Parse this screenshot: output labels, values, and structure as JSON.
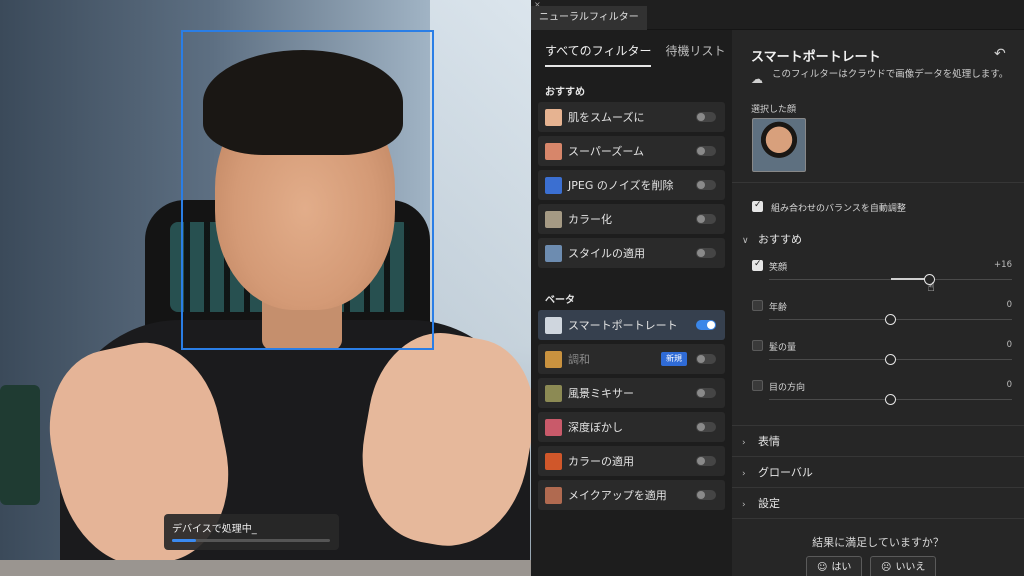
{
  "canvas": {
    "processing_text": "デバイスで処理中_",
    "progress": 0.15
  },
  "panel": {
    "tab_title": "ニューラルフィルター",
    "close_glyph": "×"
  },
  "filter_tabs": [
    "すべてのフィルター",
    "待機リスト"
  ],
  "sections": {
    "recommended": "おすすめ",
    "beta": "ベータ"
  },
  "recommended_filters": [
    {
      "label": "肌をスムーズに",
      "on": false,
      "thumb_color": "#e6b391"
    },
    {
      "label": "スーパーズーム",
      "on": false,
      "thumb_color": "#d7866a"
    },
    {
      "label": "JPEG のノイズを削除",
      "on": false,
      "thumb_color": "#3b6fd1"
    },
    {
      "label": "カラー化",
      "on": false,
      "thumb_color": "#a59a84"
    },
    {
      "label": "スタイルの適用",
      "on": false,
      "thumb_color": "#6d8cb0"
    }
  ],
  "beta_filters": [
    {
      "label": "スマートポートレート",
      "on": true,
      "thumb_color": "#cfd6de"
    },
    {
      "label": "調和",
      "on": false,
      "badge": "新規",
      "thumb_color": "#c9923f"
    },
    {
      "label": "風景ミキサー",
      "on": false,
      "thumb_color": "#8c8a54"
    },
    {
      "label": "深度ぼかし",
      "on": false,
      "thumb_color": "#c95a6a"
    },
    {
      "label": "カラーの適用",
      "on": false,
      "thumb_color": "#d0572a"
    },
    {
      "label": "メイクアップを適用",
      "on": false,
      "thumb_color": "#b06a50"
    }
  ],
  "settings": {
    "title": "スマートポートレート",
    "reset_icon": "↶",
    "cloud_icon": "☁",
    "cloud_text": "このフィルターはクラウドで画像データを処理します。",
    "selected_faces_label": "選択した顔",
    "auto_balance_label": "組み合わせのバランスを自動調整",
    "auto_balance_checked": true,
    "recommended_section": "おすすめ",
    "sliders": [
      {
        "label": "笑顔",
        "value_text": "+16",
        "value": 16,
        "checked": true
      },
      {
        "label": "年齢",
        "value_text": "0",
        "value": 0,
        "checked": false
      },
      {
        "label": "髪の量",
        "value_text": "0",
        "value": 0,
        "checked": false
      },
      {
        "label": "目の方向",
        "value_text": "0",
        "value": 0,
        "checked": false
      }
    ],
    "slider_range": [
      -50,
      50
    ],
    "collapsed_sections": [
      "表情",
      "グローバル",
      "設定"
    ],
    "feedback_question": "結果に満足していますか？",
    "yes_label": "はい",
    "no_label": "いいえ",
    "yes_icon": "☺",
    "no_icon": "☹"
  },
  "colors": {
    "accent": "#3a86e8",
    "face_box": "#2a7ee6",
    "badge": "#2f6bd6"
  }
}
